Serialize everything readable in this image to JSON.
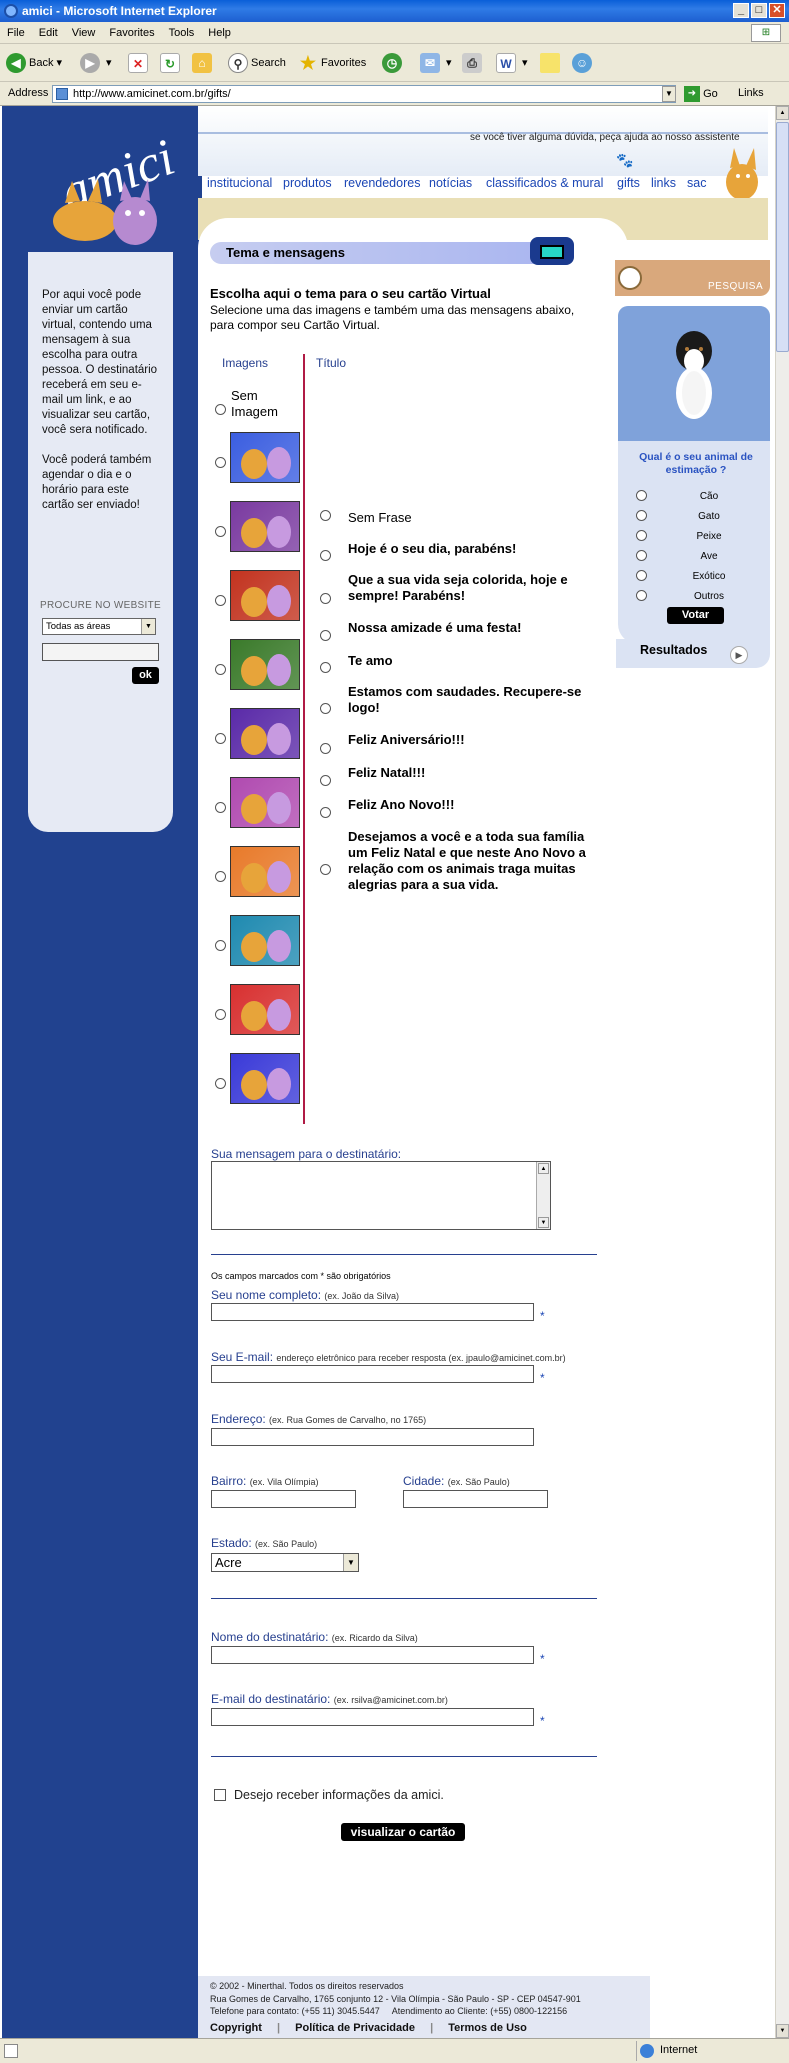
{
  "browser": {
    "title": "amici - Microsoft Internet Explorer",
    "menu": [
      "File",
      "Edit",
      "View",
      "Favorites",
      "Tools",
      "Help"
    ],
    "toolbar": {
      "back": "Back",
      "search": "Search",
      "favorites": "Favorites"
    },
    "address_label": "Address",
    "url": "http://www.amicinet.com.br/gifts/",
    "go": "Go",
    "links": "Links",
    "status": "Internet"
  },
  "header": {
    "help_text": "se você tiver alguma dúvida, peça ajuda ao nosso assistente",
    "nav": [
      "institucional",
      "produtos",
      "revendedores",
      "notícias",
      "classificados & mural",
      "gifts",
      "links",
      "sac"
    ]
  },
  "sidebar": {
    "logo": "amici",
    "description": "Por aqui você pode enviar um cartão virtual, contendo uma mensagem à sua escolha para outra pessoa. O destinatário receberá em seu e-mail um link, e ao visualizar seu cartão, você sera notificado.",
    "description2": "Você poderá também agendar o dia e o horário para este cartão ser enviado!",
    "search_label": "PROCURE NO WEBSITE",
    "search_select": "Todas as áreas",
    "search_button": "ok"
  },
  "main": {
    "section_title": "Tema e mensagens",
    "heading": "Escolha aqui o tema para o seu cartão Virtual",
    "intro": "Selecione uma das imagens e também uma das mensagens abaixo, para compor seu Cartão Virtual.",
    "col_images": "Imagens",
    "col_title": "Título",
    "no_image": "Sem Imagem",
    "messages": [
      "Sem Frase",
      "Hoje é o seu dia, parabéns!",
      "Que a sua vida seja colorida, hoje e sempre! Parabéns!",
      "Nossa amizade é uma festa!",
      "Te amo",
      "Estamos com saudades. Recupere-se logo!",
      "Feliz Aniversário!!!",
      "Feliz Natal!!!",
      "Feliz Ano Novo!!!",
      "Desejamos a você e a toda sua família um Feliz Natal e que neste Ano Novo a relação com os animais traga muitas alegrias para a sua vida."
    ],
    "thumbnail_colors": [
      "#3b5ee0",
      "#7a3aa0",
      "#c2331f",
      "#3a7a2a",
      "#5a2aa8",
      "#b04ab0",
      "#e87a2a",
      "#1f8ab0",
      "#d83030",
      "#3a3ad8"
    ],
    "message_label": "Sua mensagem para o destinatário:",
    "required_note": "Os campos marcados com * são obrigatórios",
    "fields": {
      "nome": {
        "label": "Seu nome completo:",
        "hint": "(ex. João da Silva)"
      },
      "email": {
        "label": "Seu E-mail:",
        "hint": "endereço eletrônico para receber resposta (ex. jpaulo@amicinet.com.br)"
      },
      "endereco": {
        "label": "Endereço:",
        "hint": "(ex. Rua Gomes de Carvalho, no 1765)"
      },
      "bairro": {
        "label": "Bairro:",
        "hint": "(ex. Vila Olímpia)"
      },
      "cidade": {
        "label": "Cidade:",
        "hint": "(ex. São Paulo)"
      },
      "estado": {
        "label": "Estado:",
        "hint": "(ex. São Paulo)",
        "value": "Acre"
      },
      "dest_nome": {
        "label": "Nome do destinatário:",
        "hint": "(ex. Ricardo da Silva)"
      },
      "dest_email": {
        "label": "E-mail do destinatário:",
        "hint": "(ex. rsilva@amicinet.com.br)"
      }
    },
    "required_star": "*",
    "newsletter": "Desejo receber informações da amici.",
    "submit": "visualizar o cartão"
  },
  "poll": {
    "search_label": "PESQUISA",
    "question": "Qual é o seu animal de estimação ?",
    "options": [
      "Cão",
      "Gato",
      "Peixe",
      "Ave",
      "Exótico",
      "Outros"
    ],
    "vote": "Votar",
    "results": "Resultados"
  },
  "footer": {
    "line1": "© 2002 - Minerthal. Todos os direitos reservados",
    "line2": "Rua Gomes de Carvalho, 1765 conjunto 12 - Vila Olímpia - São Paulo - SP - CEP 04547-901",
    "line3": "Telefone para contato: (+55 11) 3045.5447     Atendimento ao Cliente: (+55) 0800-122156",
    "links": [
      "Copyright",
      "Política de Privacidade",
      "Termos de Uso"
    ]
  }
}
